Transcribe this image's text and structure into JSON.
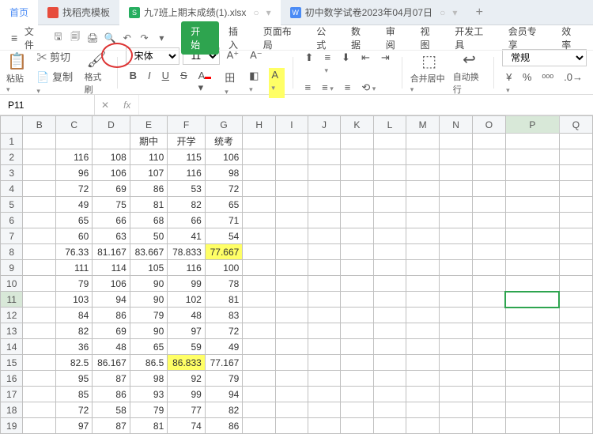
{
  "tabs": {
    "home": "首页",
    "t1": "找稻壳模板",
    "t2": "九7班上期末成绩(1).xlsx",
    "t3": "初中数学试卷2023年04月07日"
  },
  "menubar": {
    "file": "文件",
    "ribbon": [
      "开始",
      "插入",
      "页面布局",
      "公式",
      "数据",
      "审阅",
      "视图",
      "开发工具",
      "会员专享",
      "效率"
    ]
  },
  "toolbar": {
    "paste": "粘贴",
    "cut": "剪切",
    "copy": "复制",
    "format": "格式刷",
    "font": "宋体",
    "size": "11",
    "merge": "合并居中",
    "wrap": "自动换行",
    "numfmt": "常规"
  },
  "namebox": "P11",
  "fx": "fx",
  "cols": [
    "",
    "B",
    "C",
    "D",
    "E",
    "F",
    "G",
    "H",
    "I",
    "J",
    "K",
    "L",
    "M",
    "N",
    "O",
    "P",
    "Q"
  ],
  "headers": {
    "E": "期中",
    "F": "开学",
    "G": "统考"
  },
  "rows": [
    {
      "r": 1
    },
    {
      "r": 2,
      "C": "116",
      "D": "108",
      "E": "110",
      "F": "115",
      "G": "106"
    },
    {
      "r": 3,
      "C": "96",
      "D": "106",
      "E": "107",
      "F": "116",
      "G": "98"
    },
    {
      "r": 4,
      "C": "72",
      "D": "69",
      "E": "86",
      "F": "53",
      "G": "72"
    },
    {
      "r": 5,
      "C": "49",
      "D": "75",
      "E": "81",
      "F": "82",
      "G": "65"
    },
    {
      "r": 6,
      "C": "65",
      "D": "66",
      "E": "68",
      "F": "66",
      "G": "71"
    },
    {
      "r": 7,
      "C": "60",
      "D": "63",
      "E": "50",
      "F": "41",
      "G": "54"
    },
    {
      "r": 8,
      "C": "76.33",
      "D": "81.167",
      "E": "83.667",
      "F": "78.833",
      "G": "77.667",
      "hl": [
        "G"
      ]
    },
    {
      "r": 9,
      "C": "111",
      "D": "114",
      "E": "105",
      "F": "116",
      "G": "100"
    },
    {
      "r": 10,
      "C": "79",
      "D": "106",
      "E": "90",
      "F": "99",
      "G": "78"
    },
    {
      "r": 11,
      "C": "103",
      "D": "94",
      "E": "90",
      "F": "102",
      "G": "81",
      "sel": true
    },
    {
      "r": 12,
      "C": "84",
      "D": "86",
      "E": "79",
      "F": "48",
      "G": "83"
    },
    {
      "r": 13,
      "C": "82",
      "D": "69",
      "E": "90",
      "F": "97",
      "G": "72"
    },
    {
      "r": 14,
      "C": "36",
      "D": "48",
      "E": "65",
      "F": "59",
      "G": "49"
    },
    {
      "r": 15,
      "C": "82.5",
      "D": "86.167",
      "E": "86.5",
      "F": "86.833",
      "G": "77.167",
      "hl": [
        "F"
      ]
    },
    {
      "r": 16,
      "C": "95",
      "D": "87",
      "E": "98",
      "F": "92",
      "G": "79"
    },
    {
      "r": 17,
      "C": "85",
      "D": "86",
      "E": "93",
      "F": "99",
      "G": "94"
    },
    {
      "r": 18,
      "C": "72",
      "D": "58",
      "E": "79",
      "F": "77",
      "G": "82"
    },
    {
      "r": 19,
      "C": "97",
      "D": "87",
      "E": "81",
      "F": "74",
      "G": "86"
    }
  ],
  "selected": {
    "row": 11,
    "col": "P"
  }
}
